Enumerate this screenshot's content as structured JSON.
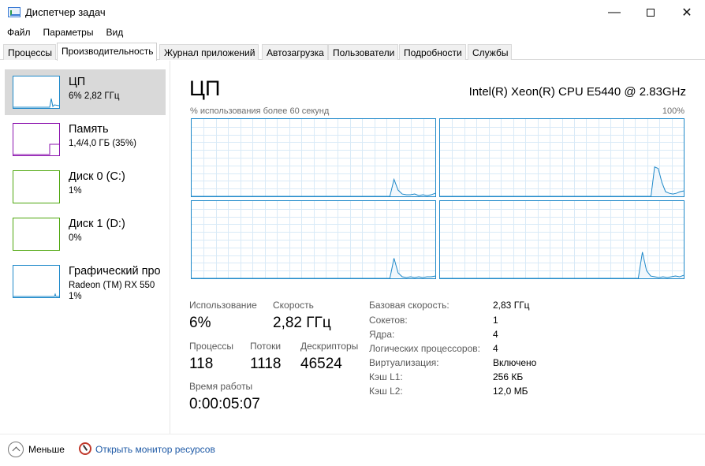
{
  "window": {
    "title": "Диспетчер задач",
    "minimize_glyph": "—",
    "close_glyph": "✕"
  },
  "menu": [
    "Файл",
    "Параметры",
    "Вид"
  ],
  "tabs": [
    {
      "label": "Процессы",
      "active": false
    },
    {
      "label": "Производительность",
      "active": true
    },
    {
      "label": "Журнал приложений",
      "active": false
    },
    {
      "label": "Автозагрузка",
      "active": false
    },
    {
      "label": "Пользователи",
      "active": false
    },
    {
      "label": "Подробности",
      "active": false
    },
    {
      "label": "Службы",
      "active": false
    }
  ],
  "sidebar": {
    "items": [
      {
        "name": "ЦП",
        "sub": "6%  2,82 ГГц",
        "sub2": "",
        "color": "#1d88c9",
        "selected": true
      },
      {
        "name": "Память",
        "sub": "1,4/4,0 ГБ (35%)",
        "sub2": "",
        "color": "#8b12ae",
        "selected": false
      },
      {
        "name": "Диск 0 (C:)",
        "sub": "1%",
        "sub2": "",
        "color": "#4da60c",
        "selected": false
      },
      {
        "name": "Диск 1 (D:)",
        "sub": "0%",
        "sub2": "",
        "color": "#4da60c",
        "selected": false
      },
      {
        "name": "Графический про",
        "sub": "Radeon (TM) RX 550",
        "sub2": "1%",
        "color": "#1d88c9",
        "selected": false
      }
    ]
  },
  "main": {
    "title": "ЦП",
    "cpu_name": "Intel(R) Xeon(R) CPU E5440 @ 2.83GHz",
    "graph_caption": "% использования более 60 секунд",
    "graph_max": "100%",
    "stats": {
      "usage_label": "Использование",
      "usage_value": "6%",
      "speed_label": "Скорость",
      "speed_value": "2,82 ГГц",
      "processes_label": "Процессы",
      "processes_value": "118",
      "threads_label": "Потоки",
      "threads_value": "1118",
      "handles_label": "Дескрипторы",
      "handles_value": "46524",
      "uptime_label": "Время работы",
      "uptime_value": "0:00:05:07"
    },
    "properties": [
      {
        "label": "Базовая скорость:",
        "value": "2,83 ГГц"
      },
      {
        "label": "Сокетов:",
        "value": "1"
      },
      {
        "label": "Ядра:",
        "value": "4"
      },
      {
        "label": "Логических процессоров:",
        "value": "4"
      },
      {
        "label": "Виртуализация:",
        "value": "Включено"
      },
      {
        "label": "Кэш L1:",
        "value": "256 КБ"
      },
      {
        "label": "Кэш L2:",
        "value": "12,0 МБ"
      }
    ]
  },
  "footer": {
    "less_label": "Меньше",
    "resmon_link": "Открыть монитор ресурсов"
  },
  "colors": {
    "cpu_accent": "#1d88c9",
    "memory_accent": "#8b12ae",
    "disk_accent": "#4da60c",
    "selected_bg": "#d9d9d9",
    "link": "#1f5aa6"
  },
  "chart_data": {
    "type": "area",
    "graphs": [
      {
        "name": "core-0",
        "values": [
          0,
          0,
          0,
          0,
          0,
          0,
          0,
          0,
          0,
          0,
          0,
          0,
          0,
          0,
          0,
          0,
          0,
          0,
          0,
          0,
          0,
          0,
          0,
          0,
          0,
          0,
          0,
          0,
          0,
          0,
          0,
          0,
          0,
          0,
          0,
          0,
          0,
          0,
          0,
          0,
          0,
          0,
          0,
          0,
          0,
          0,
          0,
          0,
          0,
          22,
          8,
          3,
          2,
          2,
          3,
          1,
          2,
          1,
          2,
          4
        ]
      },
      {
        "name": "core-1",
        "values": [
          0,
          0,
          0,
          0,
          0,
          0,
          0,
          0,
          0,
          0,
          0,
          0,
          0,
          0,
          0,
          0,
          0,
          0,
          0,
          0,
          0,
          0,
          0,
          0,
          0,
          0,
          0,
          0,
          0,
          0,
          0,
          0,
          0,
          0,
          0,
          0,
          0,
          0,
          0,
          0,
          0,
          0,
          0,
          0,
          0,
          0,
          0,
          0,
          0,
          0,
          0,
          0,
          0,
          0,
          0,
          0,
          0,
          0,
          0,
          38,
          36,
          18,
          6,
          4,
          3,
          4,
          6,
          7
        ]
      },
      {
        "name": "core-2",
        "values": [
          0,
          0,
          0,
          0,
          0,
          0,
          0,
          0,
          0,
          0,
          0,
          0,
          0,
          0,
          0,
          0,
          0,
          0,
          0,
          0,
          0,
          0,
          0,
          0,
          0,
          0,
          0,
          0,
          0,
          0,
          0,
          0,
          0,
          0,
          0,
          0,
          0,
          0,
          0,
          0,
          0,
          0,
          0,
          0,
          0,
          0,
          0,
          0,
          0,
          26,
          7,
          2,
          1,
          2,
          1,
          2,
          1,
          2,
          2,
          3
        ]
      },
      {
        "name": "core-3",
        "values": [
          0,
          0,
          0,
          0,
          0,
          0,
          0,
          0,
          0,
          0,
          0,
          0,
          0,
          0,
          0,
          0,
          0,
          0,
          0,
          0,
          0,
          0,
          0,
          0,
          0,
          0,
          0,
          0,
          0,
          0,
          0,
          0,
          0,
          0,
          0,
          0,
          0,
          0,
          0,
          0,
          0,
          0,
          0,
          0,
          0,
          0,
          0,
          0,
          0,
          34,
          10,
          3,
          2,
          1,
          2,
          1,
          2,
          3,
          2,
          4
        ]
      }
    ],
    "ylim": [
      0,
      100
    ],
    "grid": true
  }
}
